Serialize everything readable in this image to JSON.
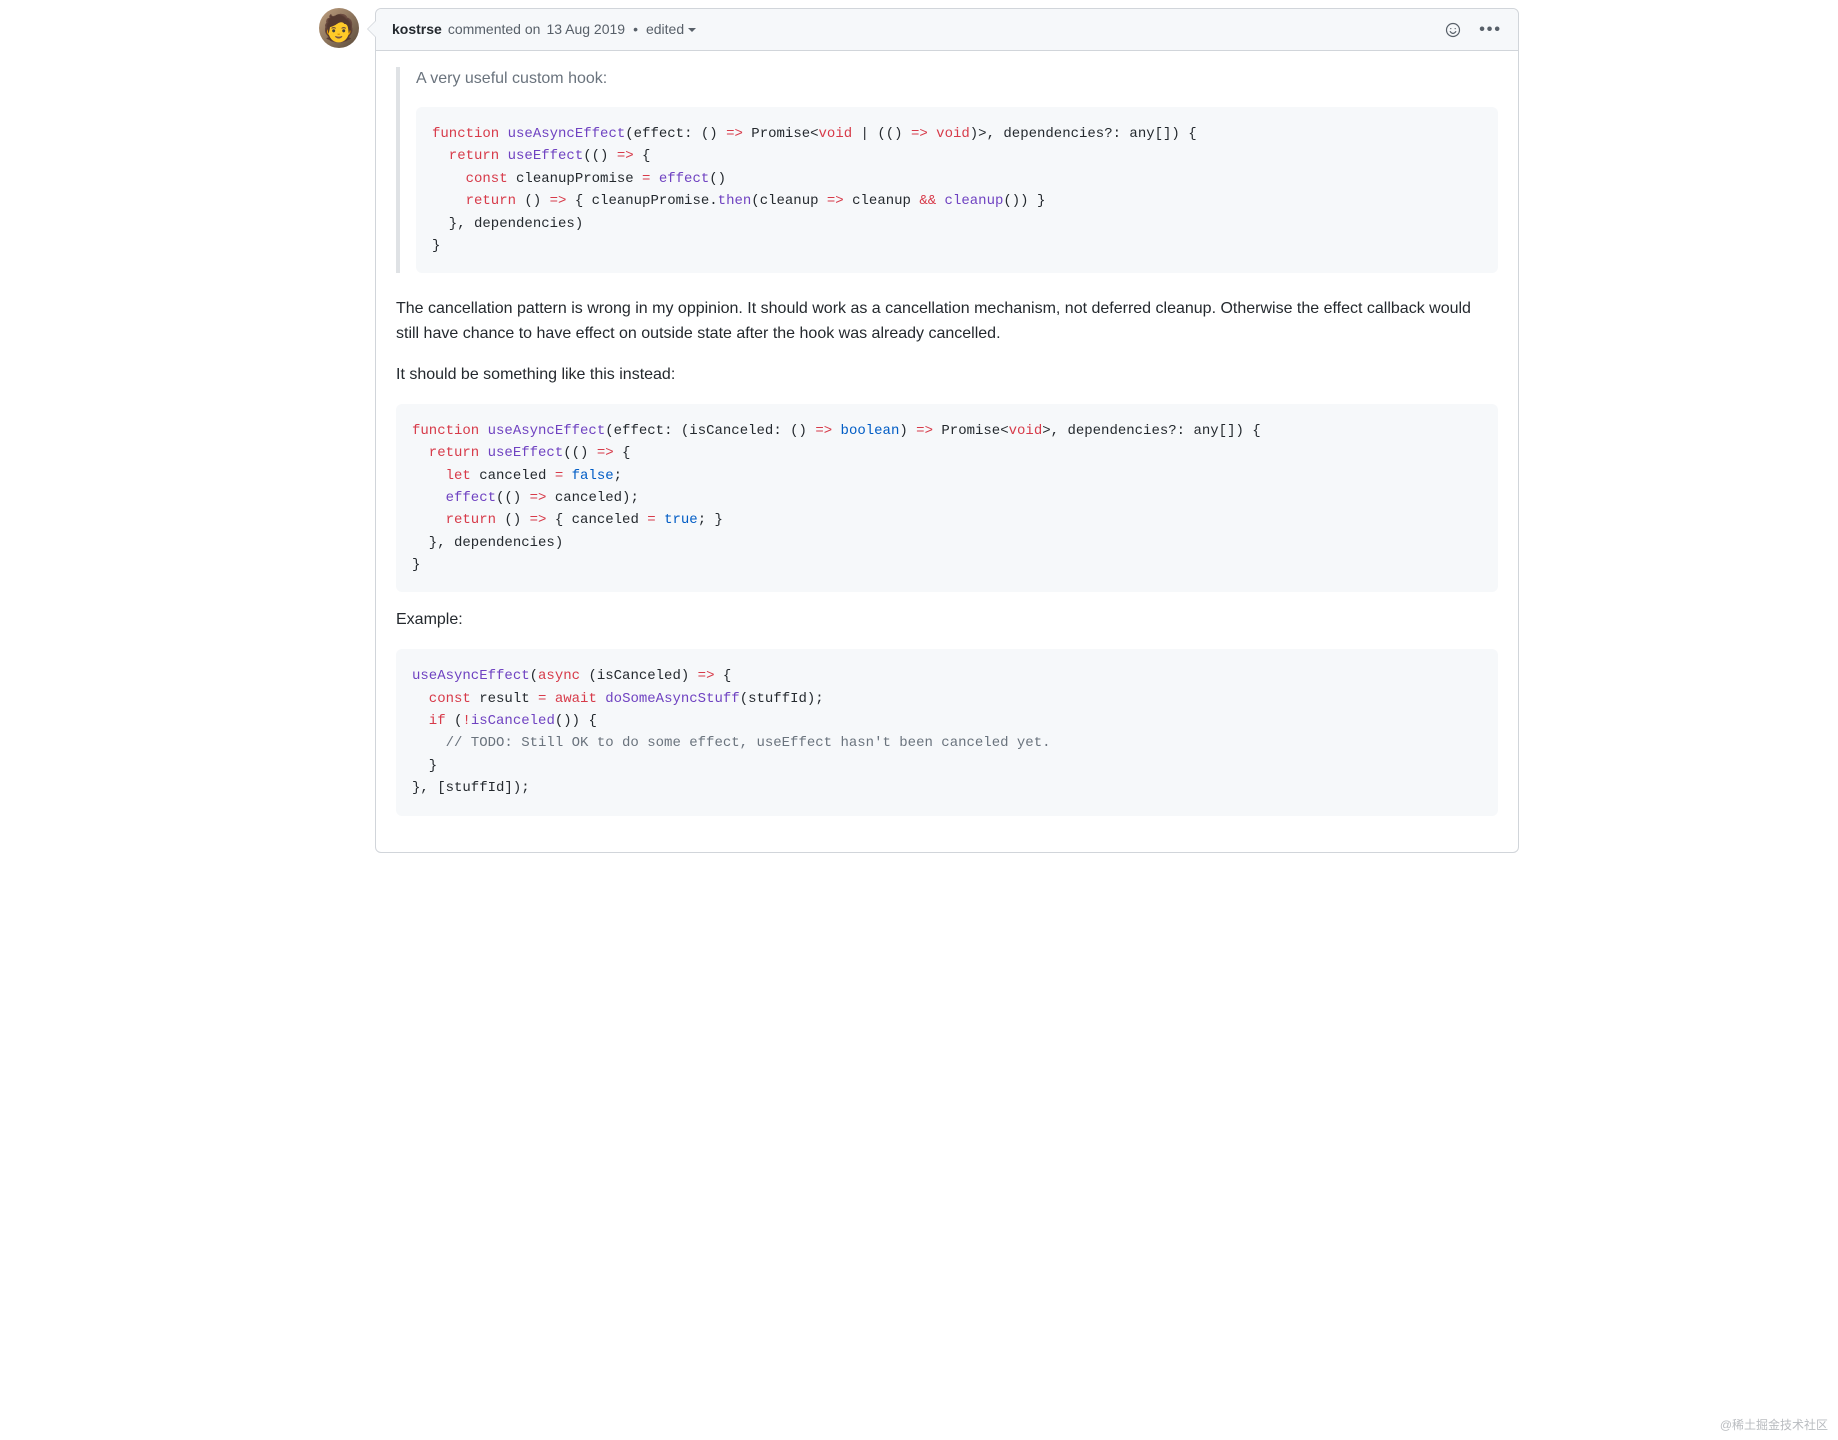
{
  "header": {
    "author": "kostrse",
    "commented_word": "commented",
    "on_word": "on",
    "timestamp": "13 Aug 2019",
    "bullet": "•",
    "edited_label": "edited"
  },
  "icons": {
    "emoji": "emoji-icon",
    "kebab": "kebab-icon",
    "dropdown": "chevron-down-icon"
  },
  "body": {
    "quote_text": "A very useful custom hook:",
    "para1": "The cancellation pattern is wrong in my oppinion. It should work as a cancellation mechanism, not deferred cleanup. Otherwise the effect callback would still have chance to have effect on outside state after the hook was already cancelled.",
    "para2": "It should be something like this instead:",
    "para3": "Example:"
  },
  "code1": {
    "l1_kw_function": "function",
    "l1_fn_name": "useAsyncEffect",
    "l1_open": "(",
    "l1_p_effect": "effect",
    "l1_colon1": ": () ",
    "l1_arrow1": "=>",
    "l1_promise": " Promise<",
    "l1_void1": "void",
    "l1_pipe": " | (() ",
    "l1_arrow2": "=>",
    "l1_void2": " void",
    "l1_closeGeneric": ")>, ",
    "l1_p_deps": "dependencies",
    "l1_depsType": "?: any[]) {",
    "l2_return": "  return",
    "l2_useEffect": " useEffect",
    "l2_rest": "(() ",
    "l2_arrow": "=>",
    "l2_brace": " {",
    "l3_const": "    const",
    "l3_var": " cleanupPromise ",
    "l3_eq": "=",
    "l3_call": " effect",
    "l3_paren": "()",
    "l4_return": "    return",
    "l4_open": " () ",
    "l4_arrow": "=>",
    "l4_body1": " { cleanupPromise.",
    "l4_then": "then",
    "l4_body2": "(",
    "l4_param": "cleanup",
    "l4_arrow2": " =>",
    "l4_body3": " cleanup ",
    "l4_and": "&&",
    "l4_call2": " cleanup",
    "l4_end": "()) }",
    "l5": "  }, dependencies)",
    "l6": "}"
  },
  "code2": {
    "l1_kw_function": "function",
    "l1_fn_name": " useAsyncEffect",
    "l1_open": "(",
    "l1_p_effect": "effect",
    "l1_sig1": ": (",
    "l1_isCanceled": "isCanceled",
    "l1_sig2": ": () ",
    "l1_arrow1": "=>",
    "l1_boolean": " boolean",
    "l1_sig3": ") ",
    "l1_arrow2": "=>",
    "l1_promise": " Promise<",
    "l1_void": "void",
    "l1_sig4": ">, ",
    "l1_p_deps": "dependencies",
    "l1_depsType": "?: any[]) {",
    "l2_return": "  return",
    "l2_useEffect": " useEffect",
    "l2_rest": "(() ",
    "l2_arrow": "=>",
    "l2_brace": " {",
    "l3_let": "    let",
    "l3_var": " canceled ",
    "l3_eq": "=",
    "l3_false": " false",
    "l3_semi": ";",
    "l4_effect": "    effect",
    "l4_open": "(() ",
    "l4_arrow": "=>",
    "l4_body": " canceled);",
    "l5_return": "    return",
    "l5_open": " () ",
    "l5_arrow": "=>",
    "l5_body1": " { canceled ",
    "l5_eq": "=",
    "l5_true": " true",
    "l5_end": "; }",
    "l6": "  }, dependencies)",
    "l7": "}"
  },
  "code3": {
    "l1_fn": "useAsyncEffect",
    "l1_open": "(",
    "l1_async": "async",
    "l1_params": " (isCanceled) ",
    "l1_arrow": "=>",
    "l1_brace": " {",
    "l2_const": "  const",
    "l2_var": " result ",
    "l2_eq": "=",
    "l2_await": " await",
    "l2_call": " doSomeAsyncStuff",
    "l2_args": "(stuffId);",
    "l3_if": "  if",
    "l3_cond_open": " (",
    "l3_not": "!",
    "l3_call": "isCanceled",
    "l3_cond_close": "()) {",
    "l4_comment": "    // TODO: Still OK to do some effect, useEffect hasn't been canceled yet.",
    "l5": "  }",
    "l6": "}, [stuffId]);"
  },
  "watermark": "@稀土掘金技术社区"
}
